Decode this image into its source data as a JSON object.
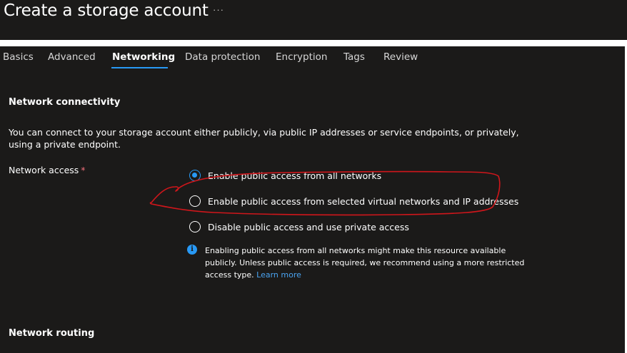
{
  "header": {
    "title": "Create a storage account",
    "more_label": "···"
  },
  "tabs": [
    {
      "label": "Basics",
      "active": false
    },
    {
      "label": "Advanced",
      "active": false
    },
    {
      "label": "Networking",
      "active": true
    },
    {
      "label": "Data protection",
      "active": false
    },
    {
      "label": "Encryption",
      "active": false
    },
    {
      "label": "Tags",
      "active": false
    },
    {
      "label": "Review",
      "active": false
    }
  ],
  "network_connectivity": {
    "heading": "Network connectivity",
    "description": "You can connect to your storage account either publicly, via public IP addresses or service endpoints, or privately, using a private endpoint.",
    "network_access_label": "Network access",
    "required_mark": "*",
    "options": [
      {
        "label": "Enable public access from all networks",
        "selected": true
      },
      {
        "label": "Enable public access from selected virtual networks and IP addresses",
        "selected": false
      },
      {
        "label": "Disable public access and use private access",
        "selected": false
      }
    ],
    "info": {
      "icon": "info-icon",
      "text": "Enabling public access from all networks might make this resource available publicly. Unless public access is required, we recommend using a more restricted access type.",
      "link_text": "Learn more"
    }
  },
  "network_routing": {
    "heading": "Network routing"
  },
  "colors": {
    "background": "#1b1a19",
    "accent": "#2899f5",
    "annotation": "#d0161b",
    "required": "#f1707b"
  }
}
